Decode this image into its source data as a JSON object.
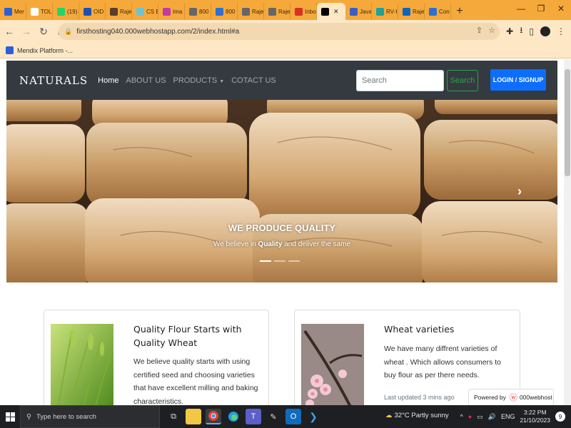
{
  "browser": {
    "tabs": [
      {
        "label": "Mer",
        "color": "#2b5ed8"
      },
      {
        "label": "TOL",
        "color": "#ffffff"
      },
      {
        "label": "(19)",
        "color": "#25d366"
      },
      {
        "label": "OID",
        "color": "#1e4fb5"
      },
      {
        "label": "Raje",
        "color": "#5a3e2b"
      },
      {
        "label": "CS E",
        "color": "#6cc3d5"
      },
      {
        "label": "Ima",
        "color": "#c03aa6"
      },
      {
        "label": "800",
        "color": "#666666"
      },
      {
        "label": "800",
        "color": "#2f6fd0"
      },
      {
        "label": "Raje",
        "color": "#666666"
      },
      {
        "label": "Raje",
        "color": "#666666"
      },
      {
        "label": "Inbo",
        "color": "#d93025"
      },
      {
        "label": "",
        "color": "#000000",
        "active": true
      },
      {
        "label": "Java",
        "color": "#3a5fc0"
      },
      {
        "label": "RV-I",
        "color": "#1ba39c"
      },
      {
        "label": "Raje",
        "color": "#0a66c2"
      },
      {
        "label": "Con",
        "color": "#2f6fd0"
      }
    ],
    "url": "firsthosting040.000webhostapp.com/2/index.html#a",
    "bookmark": "Mendix Platform -..."
  },
  "site": {
    "brand": "NATURALS",
    "nav": {
      "home": "Home",
      "about": "ABOUT US",
      "products": "PRODUCTS",
      "contact": "COTACT US"
    },
    "search_placeholder": "Search",
    "search_button": "Search",
    "login_button": "LOGIN / SIGNUP",
    "carousel": {
      "title": "WE PRODUCE QUALITY",
      "text_before": "We believe in",
      "text_bold": "Quality",
      "text_after": "and deliver the same",
      "slides": 3,
      "active_slide": 1
    },
    "cards": [
      {
        "title": "Quality Flour Starts with Quality Wheat",
        "text": "We believe quality starts with using certified seed and choosing varieties that have excellent milling and baking characteristics."
      },
      {
        "title": "Wheat varieties",
        "text": "We have many diffrent varieties of wheat . Which allows consumers to buy flour as per there needs.",
        "updated": "Last updated 3 mins ago"
      }
    ],
    "powered_by": "Powered by",
    "powered_logo": "000webhost"
  },
  "taskbar": {
    "search_placeholder": "Type here to search",
    "weather": "32°C  Partly sunny",
    "lang": "ENG",
    "time": "3:22 PM",
    "date": "21/10/2023",
    "notifications": "9"
  }
}
